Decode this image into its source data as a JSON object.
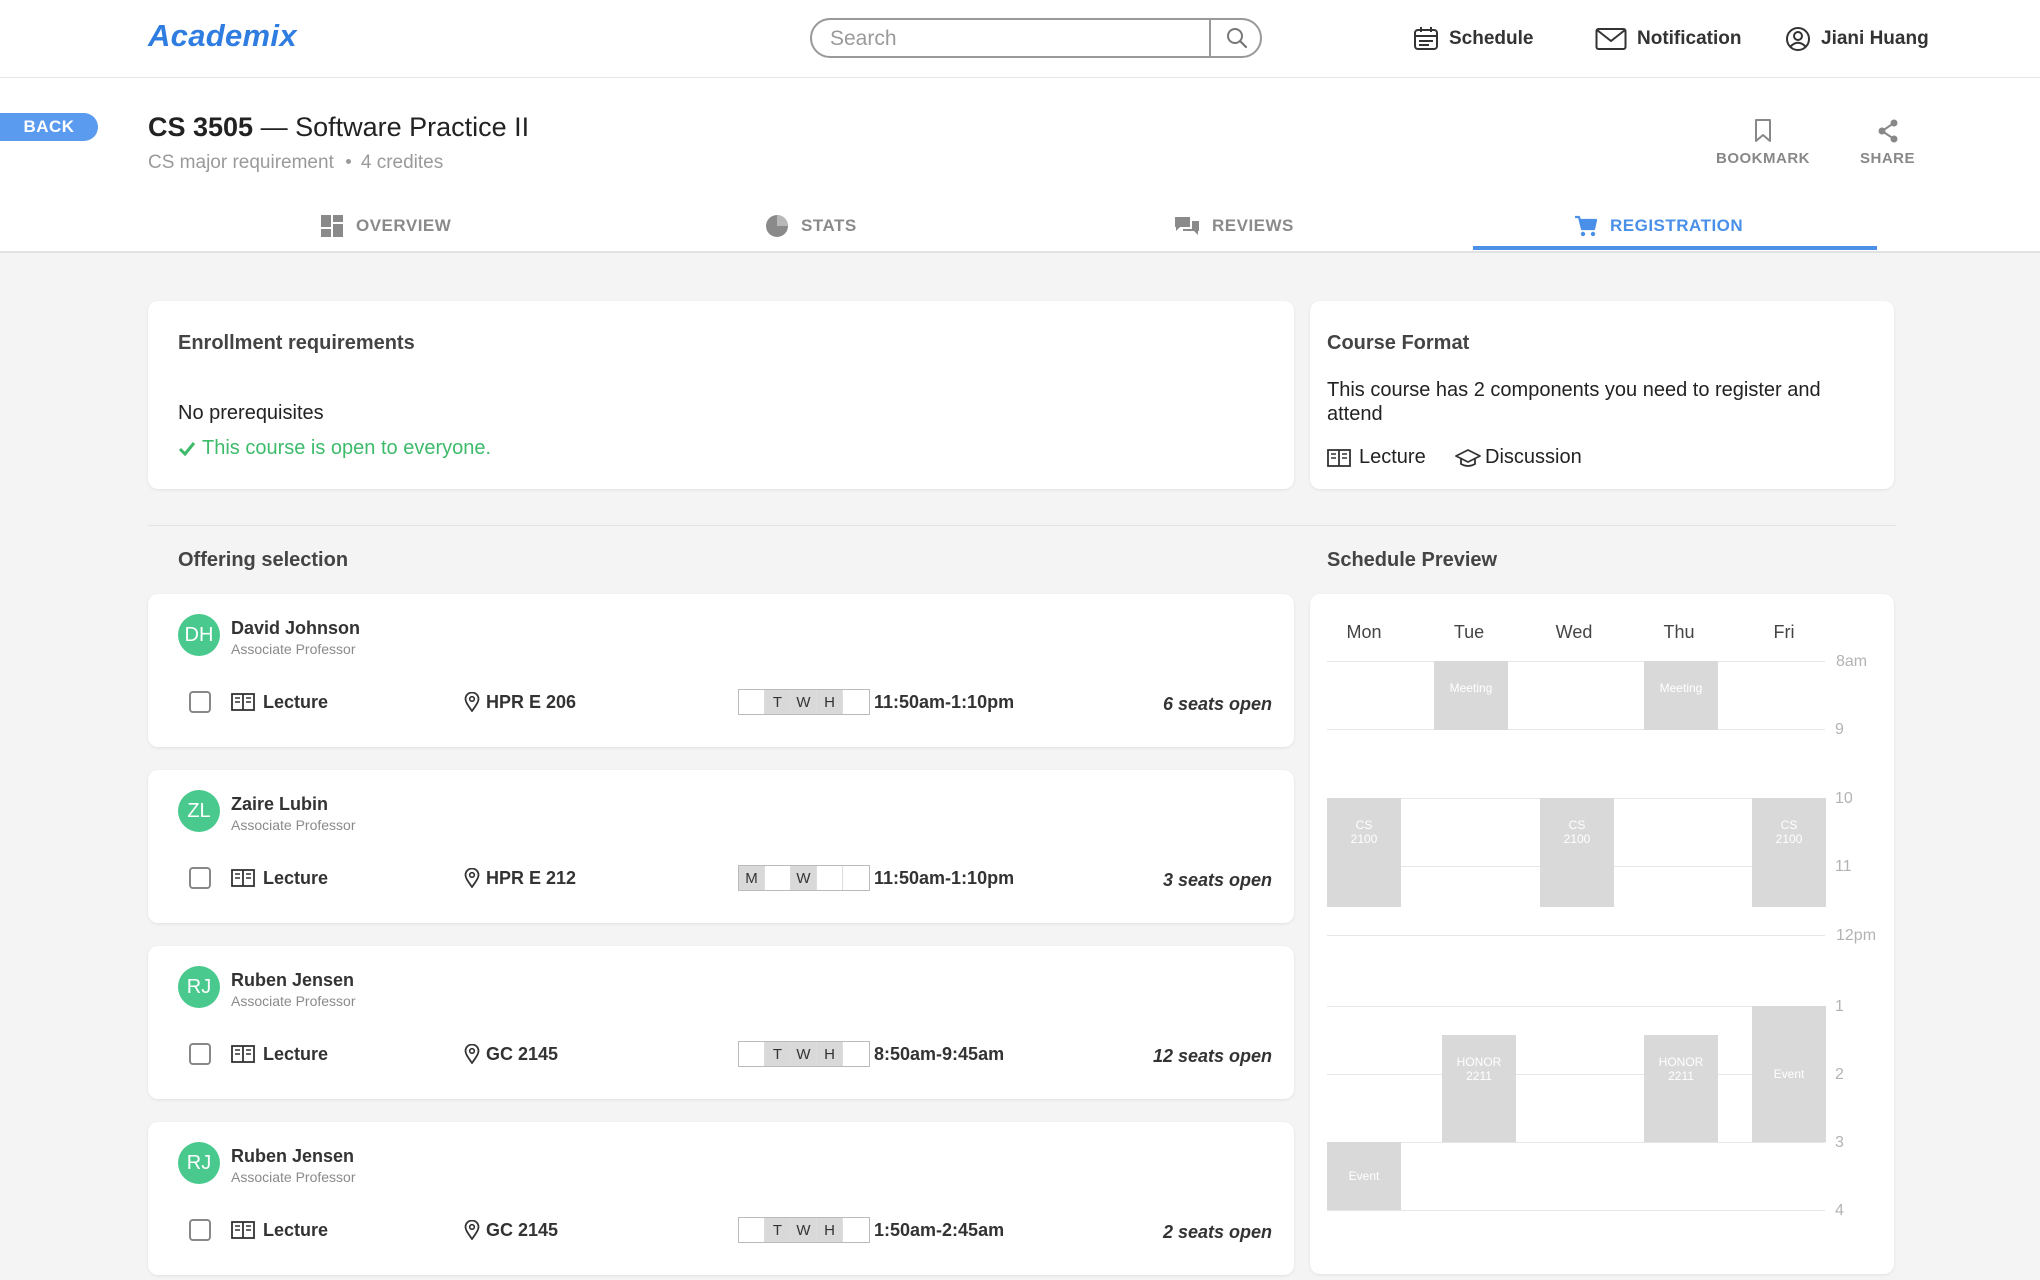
{
  "app": {
    "name": "Academix"
  },
  "search": {
    "placeholder": "Search"
  },
  "nav": {
    "schedule": "Schedule",
    "notification": "Notification",
    "user": "Jiani Huang"
  },
  "course": {
    "back_label": "BACK",
    "code": "CS 3505",
    "dash": " — ",
    "name": "Software Practice II",
    "requirement": "CS major requirement",
    "credits": "4 credites",
    "bookmark_label": "BOOKMARK",
    "share_label": "SHARE"
  },
  "tabs": [
    {
      "label": "OVERVIEW",
      "icon": "dashboard-icon"
    },
    {
      "label": "STATS",
      "icon": "pie-chart-icon"
    },
    {
      "label": "REVIEWS",
      "icon": "chat-bubbles-icon"
    },
    {
      "label": "REGISTRATION",
      "icon": "cart-icon",
      "active": true
    }
  ],
  "enrollment": {
    "title": "Enrollment requirements",
    "prereq": "No prerequisites",
    "open_text": "This course is open to everyone."
  },
  "format": {
    "title": "Course Format",
    "desc": "This course has 2 components you need to register and attend",
    "components": [
      "Lecture",
      "Discussion"
    ]
  },
  "offering": {
    "title": "Offering selection",
    "items": [
      {
        "initials": "DH",
        "name": "David Johnson",
        "role": "Associate Professor",
        "component": "Lecture",
        "location": "HPR E 206",
        "days": [
          "",
          "T",
          "W",
          "H",
          ""
        ],
        "time": "11:50am-1:10pm",
        "seats": "6 seats open"
      },
      {
        "initials": "ZL",
        "name": "Zaire Lubin",
        "role": "Associate Professor",
        "component": "Lecture",
        "location": "HPR E 212",
        "days": [
          "M",
          "",
          "W",
          "",
          ""
        ],
        "time": "11:50am-1:10pm",
        "seats": "3 seats open"
      },
      {
        "initials": "RJ",
        "name": "Ruben Jensen",
        "role": "Associate Professor",
        "component": "Lecture",
        "location": "GC 2145",
        "days": [
          "",
          "T",
          "W",
          "H",
          ""
        ],
        "time": "8:50am-9:45am",
        "seats": "12 seats open"
      },
      {
        "initials": "RJ",
        "name": "Ruben Jensen",
        "role": "Associate Professor",
        "component": "Lecture",
        "location": "GC 2145",
        "days": [
          "",
          "T",
          "W",
          "H",
          ""
        ],
        "time": "1:50am-2:45am",
        "seats": "2 seats open"
      }
    ]
  },
  "schedule": {
    "title": "Schedule Preview",
    "days": [
      "Mon",
      "Tue",
      "Wed",
      "Thu",
      "Fri"
    ],
    "hours": [
      "8am",
      "9",
      "10",
      "11",
      "12pm",
      "1",
      "2",
      "3",
      "4"
    ],
    "events": [
      {
        "label": "Meeting",
        "label2": ""
      },
      {
        "label": "Meeting",
        "label2": ""
      },
      {
        "label": "CS",
        "label2": "2100"
      },
      {
        "label": "CS",
        "label2": "2100"
      },
      {
        "label": "CS",
        "label2": "2100"
      },
      {
        "label": "HONOR",
        "label2": "2211"
      },
      {
        "label": "HONOR",
        "label2": "2211"
      },
      {
        "label": "Event",
        "label2": ""
      },
      {
        "label": "Event",
        "label2": ""
      }
    ]
  },
  "colors": {
    "accent": "#4a8fe8",
    "avatar": "#49c98e",
    "success": "#3dbb6b",
    "event": "#d9d9d9"
  }
}
